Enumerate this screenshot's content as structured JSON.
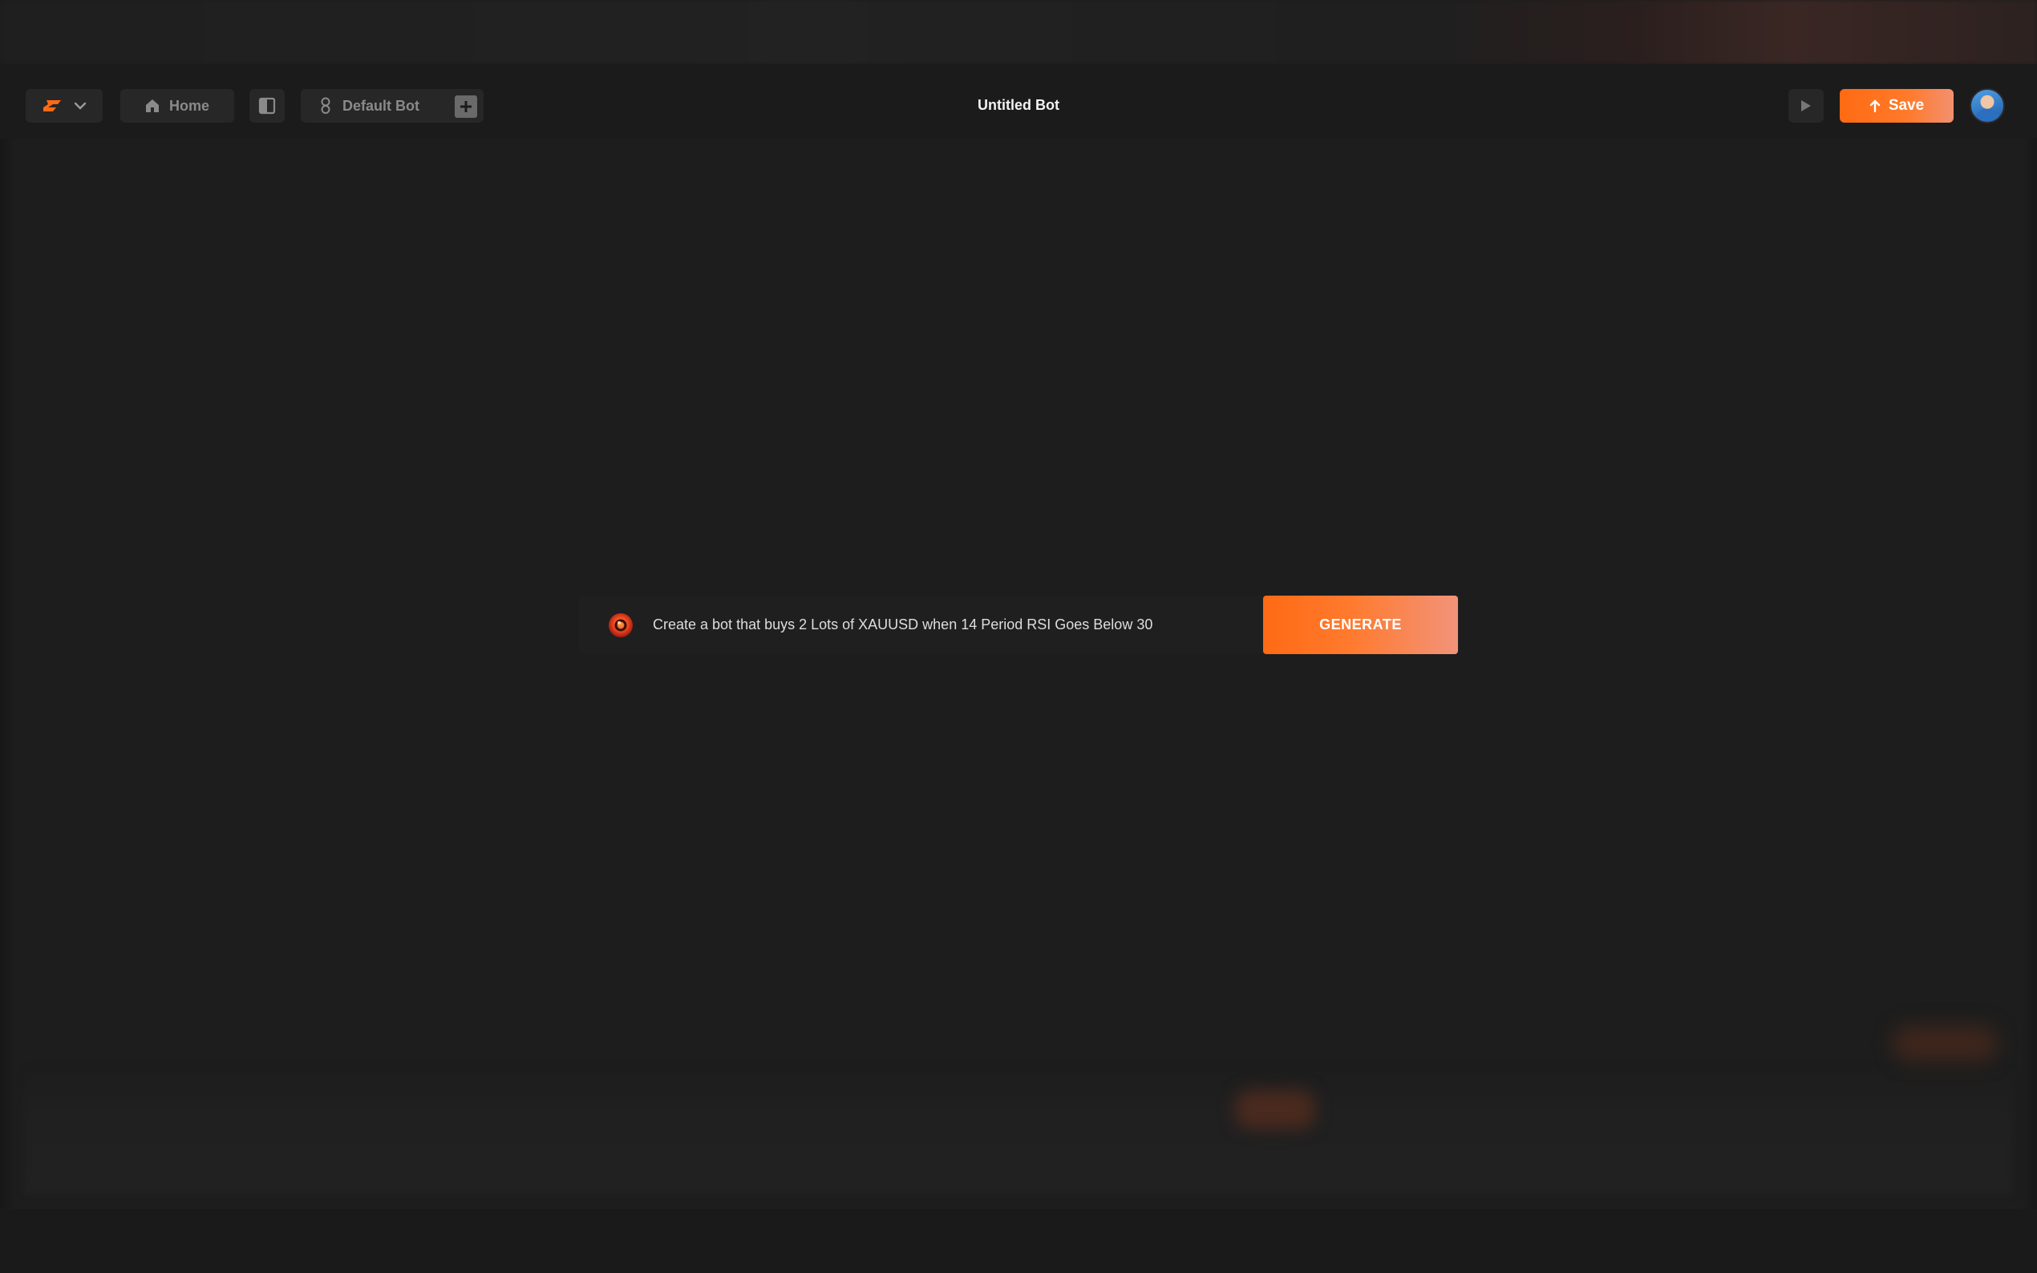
{
  "header": {
    "title": "Untitled Bot",
    "home_label": "Home",
    "bot_tab_label": "Default Bot",
    "save_label": "Save"
  },
  "prompt": {
    "value": "Create a bot that buys 2 Lots of XAUUSD when 14 Period RSI Goes Below 30",
    "button_label": "GENERATE"
  },
  "icons": {
    "logo": "brand-logo-icon",
    "logo_menu": "chevron-down-icon",
    "home": "home-icon",
    "panel": "sidebar-toggle-icon",
    "bot": "bot-icon",
    "add": "plus-icon",
    "run": "play-icon",
    "save": "arrow-up-icon",
    "prompt": "ai-spark-icon"
  },
  "colors": {
    "accent": "#ff6a14",
    "background": "#1d1d1d",
    "header": "#1b1b1b"
  }
}
